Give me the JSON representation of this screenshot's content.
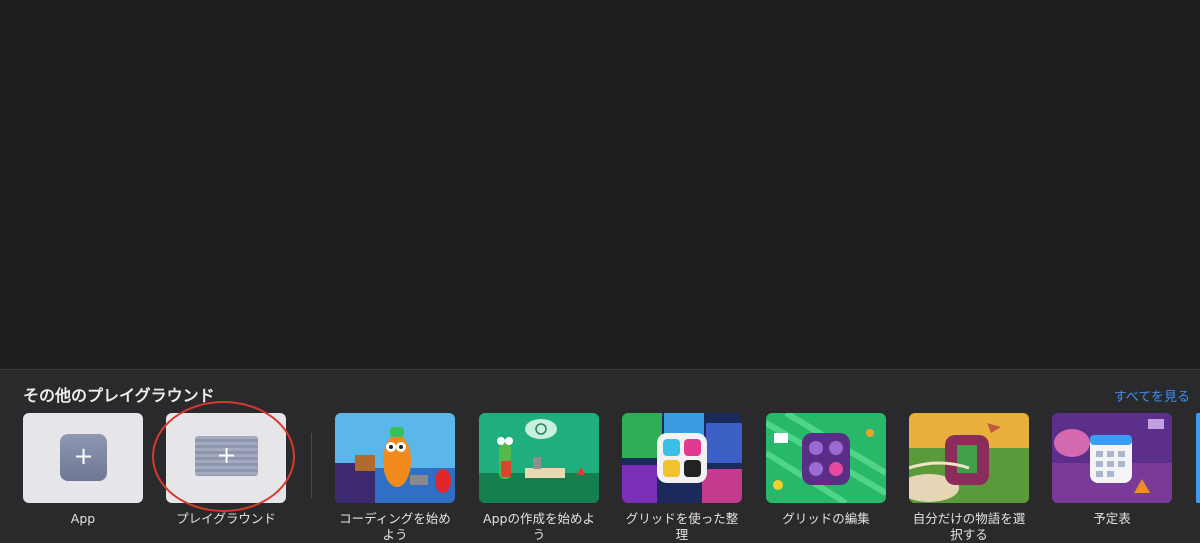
{
  "section": {
    "title": "その他のプレイグラウンド",
    "see_all": "すべてを見る"
  },
  "new_items": [
    {
      "label": "App",
      "icon": "plus-icon"
    },
    {
      "label": "プレイグラウンド",
      "icon": "plus-icon"
    }
  ],
  "templates": [
    {
      "label": "コーディングを始めよう"
    },
    {
      "label": "Appの作成を始めよう"
    },
    {
      "label": "グリッドを使った整理"
    },
    {
      "label": "グリッドの編集"
    },
    {
      "label": "自分だけの物語を選択する"
    },
    {
      "label": "予定表"
    }
  ],
  "colors": {
    "background": "#1e1e1f",
    "panel": "#2a2a2c",
    "accent_link": "#3b8ff6",
    "annotation_circle": "#d63a2c"
  }
}
